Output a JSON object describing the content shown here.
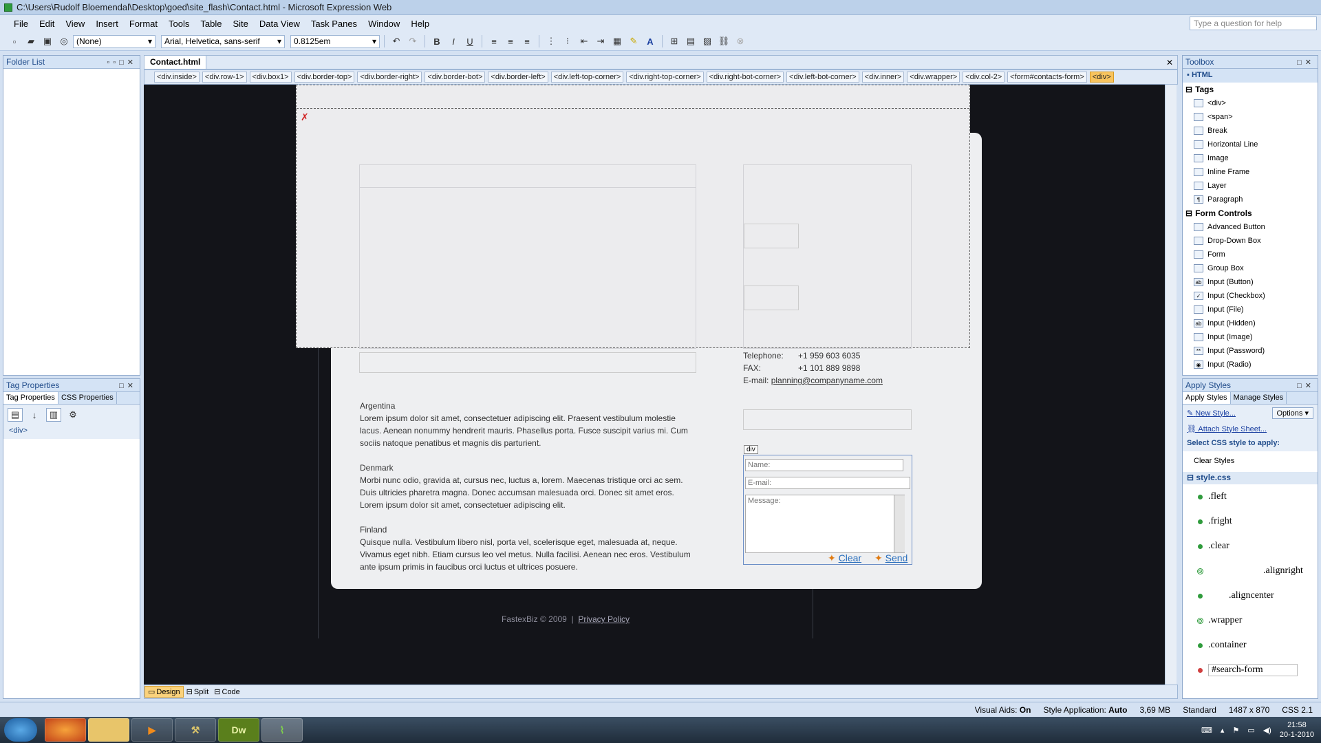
{
  "window": {
    "title": "C:\\Users\\Rudolf Bloemendal\\Desktop\\goed\\site_flash\\Contact.html - Microsoft Expression Web"
  },
  "menu": [
    "File",
    "Edit",
    "View",
    "Insert",
    "Format",
    "Tools",
    "Table",
    "Site",
    "Data View",
    "Task Panes",
    "Window",
    "Help"
  ],
  "help_placeholder": "Type a question for help",
  "toolbar": {
    "style": "(None)",
    "font": "Arial, Helvetica, sans-serif",
    "size": "0.8125em"
  },
  "folder_list": {
    "title": "Folder List"
  },
  "tag_properties": {
    "title": "Tag Properties",
    "tabs": [
      "Tag Properties",
      "CSS Properties"
    ],
    "tag": "<div>"
  },
  "editor": {
    "tab": "Contact.html",
    "quick_tags": [
      "<div.inside>",
      "<div.row-1>",
      "<div.box1>",
      "<div.border-top>",
      "<div.border-right>",
      "<div.border-bot>",
      "<div.border-left>",
      "<div.left-top-corner>",
      "<div.right-top-corner>",
      "<div.right-bot-corner>",
      "<div.left-bot-corner>",
      "<div.inner>",
      "<div.wrapper>",
      "<div.col-2>",
      "<form#contacts-form>",
      "<div>"
    ]
  },
  "page": {
    "contact": {
      "tel_label": "Telephone:",
      "tel": "+1 959 603 6035",
      "fax_label": "FAX:",
      "fax": "+1 101 889 9898",
      "email_label": "E-mail:",
      "email": "planning@companyname.com"
    },
    "div_label": "div",
    "form": {
      "name_ph": "Name:",
      "email_ph": "E-mail:",
      "msg_ph": "Message:",
      "clear": "Clear",
      "send": "Send"
    },
    "countries": [
      {
        "name": "Argentina",
        "text": "Lorem ipsum dolor sit amet, consectetuer adipiscing elit. Praesent vestibulum molestie lacus. Aenean nonummy hendrerit mauris. Phasellus porta. Fusce suscipit varius mi. Cum sociis natoque penatibus et magnis dis parturient."
      },
      {
        "name": "Denmark",
        "text": "Morbi nunc odio, gravida at, cursus nec, luctus a, lorem. Maecenas tristique orci ac sem. Duis ultricies pharetra magna. Donec accumsan malesuada orci. Donec sit amet eros. Lorem ipsum dolor sit amet, consectetuer adipiscing elit."
      },
      {
        "name": "Finland",
        "text": "Quisque nulla. Vestibulum libero nisl, porta vel, scelerisque eget, malesuada at, neque. Vivamus eget nibh. Etiam cursus leo vel metus. Nulla facilisi. Aenean nec eros. Vestibulum ante ipsum primis in faucibus orci luctus et ultrices posuere."
      }
    ],
    "footer": {
      "copy": "FastexBiz © 2009",
      "sep": "|",
      "privacy": "Privacy Policy"
    }
  },
  "view_tabs": [
    "Design",
    "Split",
    "Code"
  ],
  "toolbox": {
    "title": "Toolbox",
    "root": "HTML",
    "tags_h": "Tags",
    "tags": [
      "<div>",
      "<span>",
      "Break",
      "Horizontal Line",
      "Image",
      "Inline Frame",
      "Layer",
      "Paragraph"
    ],
    "form_h": "Form Controls",
    "forms": [
      "Advanced Button",
      "Drop-Down Box",
      "Form",
      "Group Box",
      "Input (Button)",
      "Input (Checkbox)",
      "Input (File)",
      "Input (Hidden)",
      "Input (Image)",
      "Input (Password)",
      "Input (Radio)"
    ]
  },
  "apply_styles": {
    "title": "Apply Styles",
    "tabs": [
      "Apply Styles",
      "Manage Styles"
    ],
    "new_style": "New Style...",
    "options": "Options",
    "attach": "Attach Style Sheet...",
    "select_label": "Select CSS style to apply:",
    "clear": "Clear Styles",
    "sheet": "style.css",
    "styles": [
      ".fleft",
      ".fright",
      ".clear",
      ".alignright",
      ".aligncenter",
      ".wrapper",
      ".container",
      "#search-form"
    ]
  },
  "status": {
    "visual_aids_label": "Visual Aids:",
    "visual_aids": "On",
    "style_app_label": "Style Application:",
    "style_app": "Auto",
    "size": "3,69 MB",
    "mode": "Standard",
    "dims": "1487 x 870",
    "css": "CSS 2.1"
  },
  "tray": {
    "time": "21:58",
    "date": "20-1-2010"
  }
}
